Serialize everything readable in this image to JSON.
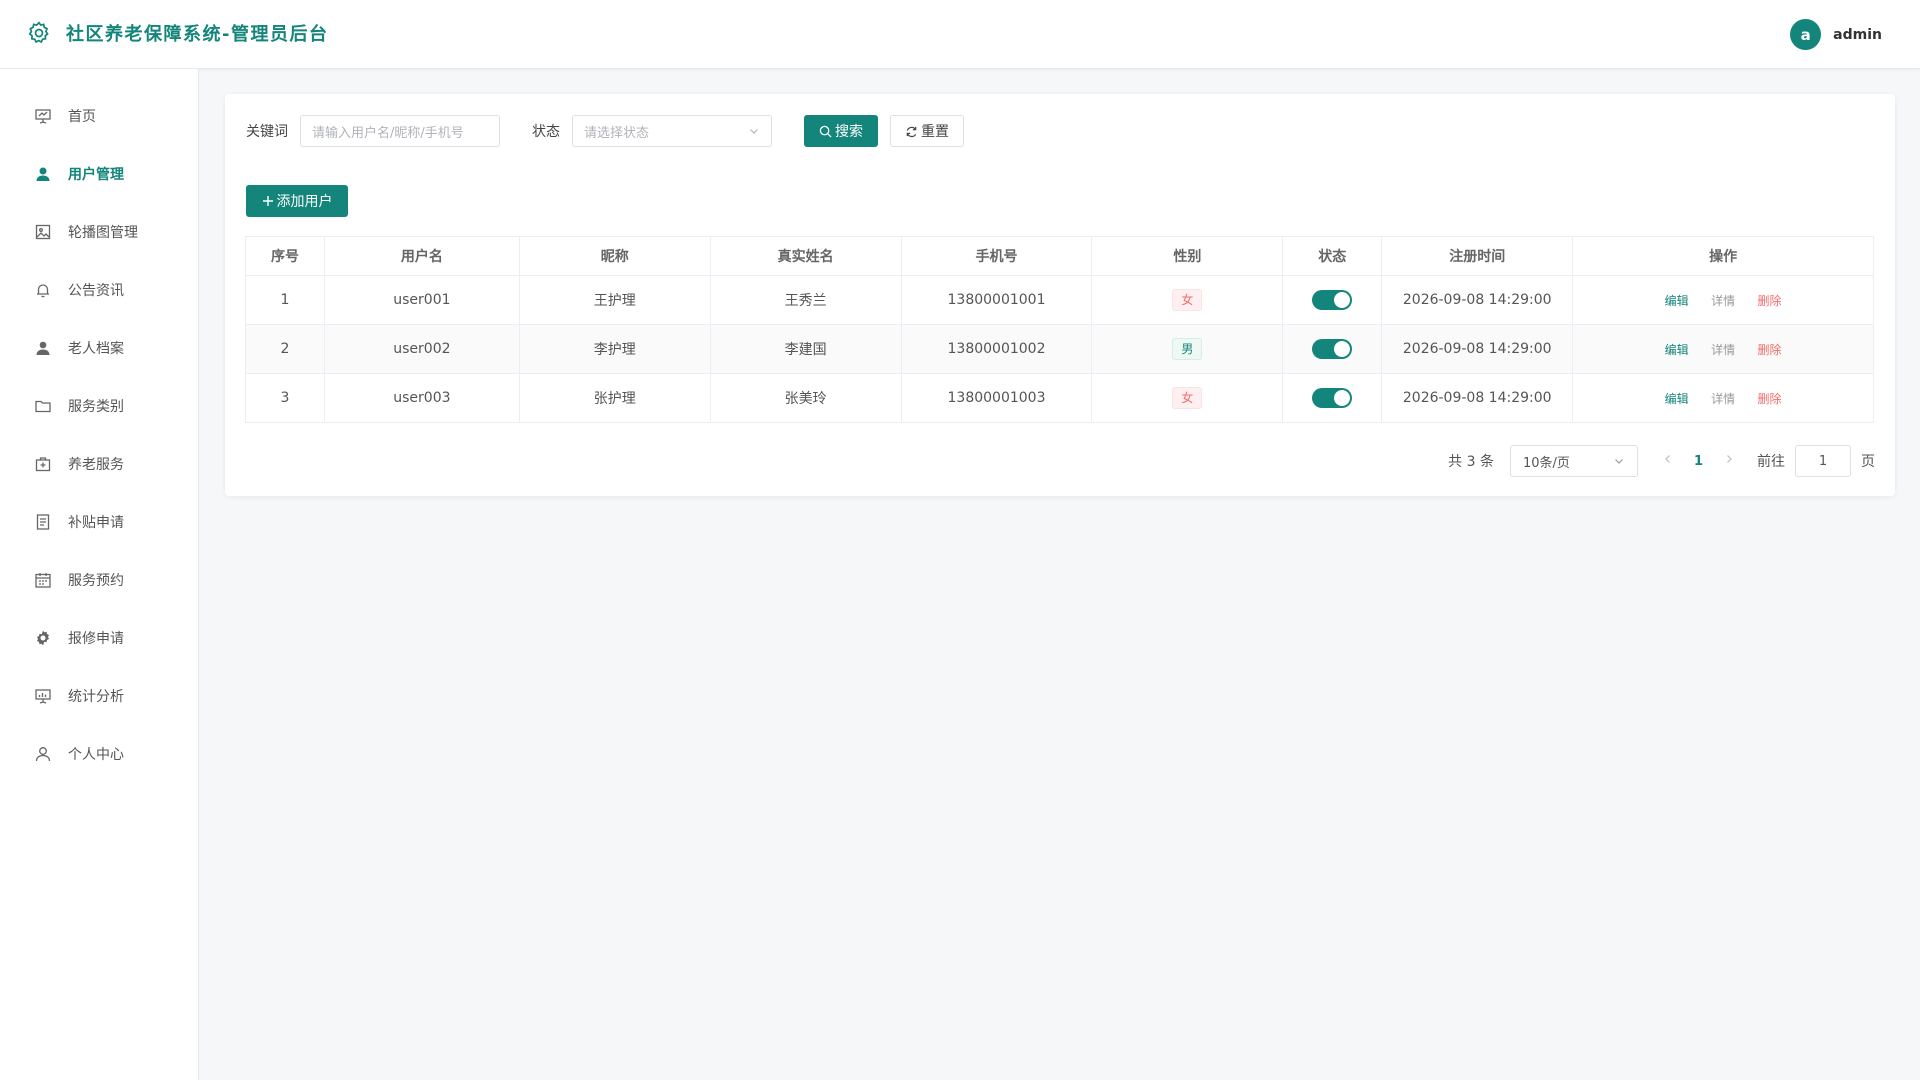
{
  "header": {
    "title": "社区养老保障系统-管理员后台",
    "avatar_letter": "a",
    "username": "admin"
  },
  "sidebar": {
    "items": [
      {
        "label": "首页",
        "icon": "presentation-icon"
      },
      {
        "label": "用户管理",
        "icon": "user-filled-icon",
        "active": true
      },
      {
        "label": "轮播图管理",
        "icon": "picture-icon"
      },
      {
        "label": "公告资讯",
        "icon": "bell-icon"
      },
      {
        "label": "老人档案",
        "icon": "user-icon"
      },
      {
        "label": "服务类别",
        "icon": "folder-icon"
      },
      {
        "label": "养老服务",
        "icon": "first-aid-kit-icon"
      },
      {
        "label": "补贴申请",
        "icon": "document-icon"
      },
      {
        "label": "服务预约",
        "icon": "calendar-icon"
      },
      {
        "label": "报修申请",
        "icon": "gear-icon"
      },
      {
        "label": "统计分析",
        "icon": "chart-board-icon"
      },
      {
        "label": "个人中心",
        "icon": "person-icon"
      }
    ]
  },
  "search": {
    "keyword_label": "关键词",
    "keyword_placeholder": "请输入用户名/昵称/手机号",
    "status_label": "状态",
    "status_placeholder": "请选择状态",
    "search_button": "搜索",
    "reset_button": "重置"
  },
  "toolbar": {
    "add_button": "添加用户"
  },
  "table": {
    "headers": [
      "序号",
      "用户名",
      "昵称",
      "真实姓名",
      "手机号",
      "性别",
      "状态",
      "注册时间",
      "操作"
    ],
    "rows": [
      {
        "index": "1",
        "username": "user001",
        "nickname": "王护理",
        "realname": "王秀兰",
        "phone": "13800001001",
        "gender": "女",
        "enabled": true,
        "registered": "2026-09-08 14:29:00"
      },
      {
        "index": "2",
        "username": "user002",
        "nickname": "李护理",
        "realname": "李建国",
        "phone": "13800001002",
        "gender": "男",
        "enabled": true,
        "registered": "2026-09-08 14:29:00"
      },
      {
        "index": "3",
        "username": "user003",
        "nickname": "张护理",
        "realname": "张美玲",
        "phone": "13800001003",
        "gender": "女",
        "enabled": true,
        "registered": "2026-09-08 14:29:00"
      }
    ],
    "actions": {
      "edit": "编辑",
      "detail": "详情",
      "delete": "删除"
    }
  },
  "pagination": {
    "total_text": "共 3 条",
    "page_size": "10条/页",
    "current_page": "1",
    "goto_label": "前往",
    "goto_value": "1",
    "page_suffix": "页"
  },
  "colors": {
    "accent": "#13857a",
    "danger": "#f56c6c",
    "background": "#f5f7f9"
  }
}
